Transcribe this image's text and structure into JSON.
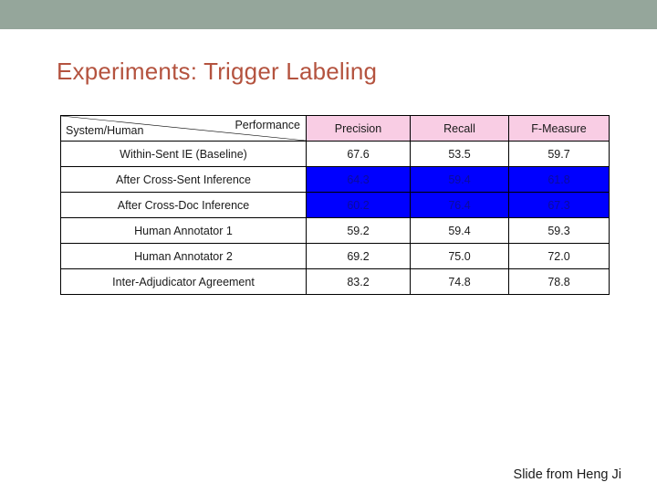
{
  "banner": {
    "color": "#95a69b"
  },
  "title": "Experiments: Trigger Labeling",
  "title_color": "#b4533f",
  "table": {
    "corner": {
      "performance_label": "Performance",
      "system_label": "System/Human"
    },
    "columns": [
      "Precision",
      "Recall",
      "F-Measure"
    ],
    "header_bg": "#f9cde4",
    "highlight_bg": "#0000ff",
    "rows": [
      {
        "label": "Within-Sent IE (Baseline)",
        "precision": "67.6",
        "recall": "53.5",
        "fmeasure": "59.7",
        "highlight": false
      },
      {
        "label": "After Cross-Sent Inference",
        "precision": "64.3",
        "recall": "59.4",
        "fmeasure": "61.8",
        "highlight": true
      },
      {
        "label": "After Cross-Doc Inference",
        "precision": "60.2",
        "recall": "76.4",
        "fmeasure": "67.3",
        "highlight": true
      },
      {
        "label": "Human Annotator 1",
        "precision": "59.2",
        "recall": "59.4",
        "fmeasure": "59.3",
        "highlight": false
      },
      {
        "label": "Human Annotator 2",
        "precision": "69.2",
        "recall": "75.0",
        "fmeasure": "72.0",
        "highlight": false
      },
      {
        "label": "Inter-Adjudicator Agreement",
        "precision": "83.2",
        "recall": "74.8",
        "fmeasure": "78.8",
        "highlight": false
      }
    ]
  },
  "credit": "Slide from Heng Ji"
}
